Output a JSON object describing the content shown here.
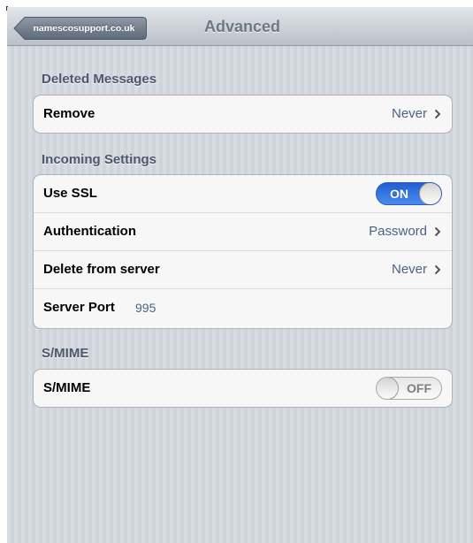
{
  "navbar": {
    "back_label": "namescosupport.co.uk",
    "title": "Advanced"
  },
  "sections": {
    "deleted": {
      "header": "Deleted Messages",
      "remove": {
        "label": "Remove",
        "value": "Never"
      }
    },
    "incoming": {
      "header": "Incoming Settings",
      "use_ssl": {
        "label": "Use SSL",
        "toggle": "ON",
        "state": true
      },
      "authentication": {
        "label": "Authentication",
        "value": "Password"
      },
      "delete_from_server": {
        "label": "Delete from server",
        "value": "Never"
      },
      "server_port": {
        "label": "Server Port",
        "value": "995"
      }
    },
    "smime": {
      "header": "S/MIME",
      "smime": {
        "label": "S/MIME",
        "toggle": "OFF",
        "state": false
      }
    }
  },
  "colors": {
    "background": "#cfd3da",
    "value_text": "#4c6285",
    "section_header": "#4c566c",
    "toggle_on": "#2f74e0"
  },
  "icons": {
    "back": "back-arrow-button",
    "disclosure": "chevron-right-icon"
  }
}
